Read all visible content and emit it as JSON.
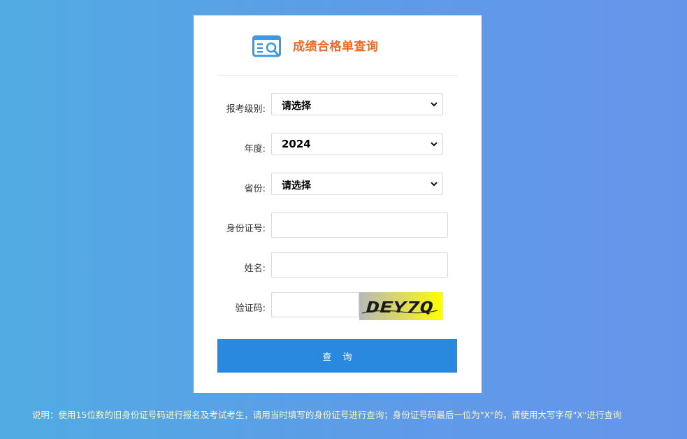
{
  "header": {
    "title": "成绩合格单查询",
    "icon": "search-document-icon"
  },
  "form": {
    "level": {
      "label": "报考级别:",
      "value": "请选择"
    },
    "year": {
      "label": "年度:",
      "value": "2024"
    },
    "province": {
      "label": "省份:",
      "value": "请选择"
    },
    "id_number": {
      "label": "身份证号:",
      "value": "",
      "placeholder": ""
    },
    "name": {
      "label": "姓名:",
      "value": "",
      "placeholder": ""
    },
    "captcha": {
      "label": "验证码:",
      "value": "",
      "placeholder": "",
      "image_text": "DEY7Q"
    }
  },
  "submit_label": "查 询",
  "note": "说明：使用15位数的旧身份证号码进行报名及考试考生，请用当时填写的身份证号进行查询；身份证号码最后一位为\"X\"的，请使用大写字母\"X\"进行查询",
  "colors": {
    "accent": "#2989df",
    "title": "#ee6a24",
    "note": "#fbf6c6",
    "bg_start": "#51abe2",
    "bg_end": "#6595ea"
  }
}
